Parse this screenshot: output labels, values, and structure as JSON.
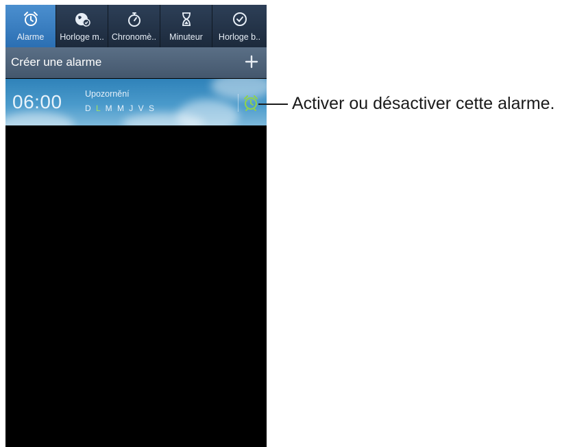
{
  "tabs": [
    {
      "label": "Alarme",
      "icon": "alarm-clock-icon",
      "active": true
    },
    {
      "label": "Horloge m..",
      "icon": "world-clock-icon",
      "active": false
    },
    {
      "label": "Chronomè..",
      "icon": "stopwatch-icon",
      "active": false
    },
    {
      "label": "Minuteur",
      "icon": "hourglass-icon",
      "active": false
    },
    {
      "label": "Horloge b..",
      "icon": "desk-clock-icon",
      "active": false
    }
  ],
  "create_row": {
    "label": "Créer une alarme",
    "icon": "plus-icon"
  },
  "alarm": {
    "time": "06:00",
    "name": "Upozornění",
    "days": [
      {
        "label": "D",
        "active": false
      },
      {
        "label": "L",
        "active": true
      },
      {
        "label": "M",
        "active": false
      },
      {
        "label": "M",
        "active": false
      },
      {
        "label": "J",
        "active": false
      },
      {
        "label": "V",
        "active": false
      },
      {
        "label": "S",
        "active": false
      }
    ],
    "toggle_icon": "alarm-clock-icon",
    "toggle_on": true
  },
  "callout": {
    "text": "Activer ou désactiver cette alarme."
  },
  "colors": {
    "active_tab": "#3f84c6",
    "toggle_green": "#8fd14f",
    "day_active": "#a6e35a"
  }
}
